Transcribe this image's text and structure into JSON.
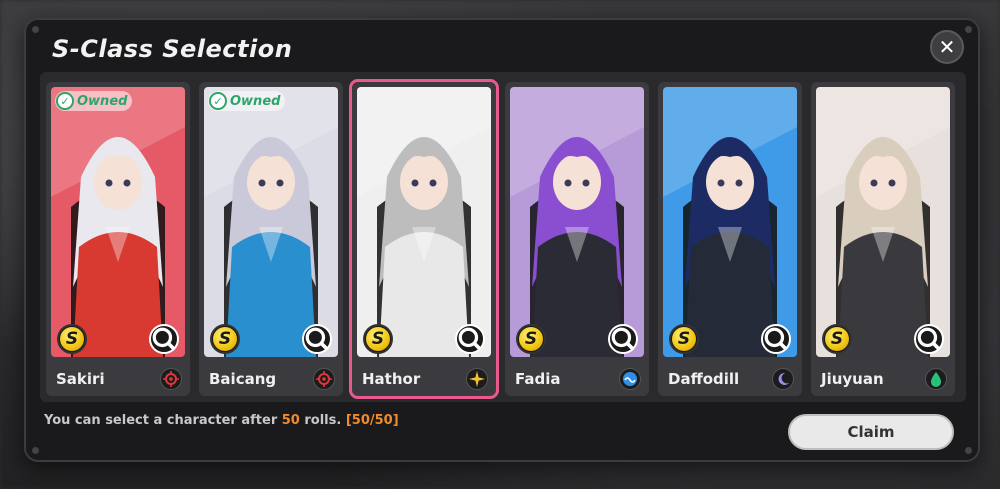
{
  "dialog": {
    "title": "S-Class Selection",
    "close_icon": "close-icon"
  },
  "characters": [
    {
      "name": "Sakiri",
      "owned": true,
      "owned_label": "Owned",
      "rank": "S",
      "element_icon": "crosshair-icon",
      "element_color": "#e0373b",
      "art_bg": "#e65a67",
      "hair": "#e8e8ee",
      "outfit": "#d83a32",
      "selected": false
    },
    {
      "name": "Baicang",
      "owned": true,
      "owned_label": "Owned",
      "rank": "S",
      "element_icon": "crosshair-icon",
      "element_color": "#e0373b",
      "art_bg": "#dcdce6",
      "hair": "#c9c9d9",
      "outfit": "#2a8fcf",
      "selected": false
    },
    {
      "name": "Hathor",
      "owned": false,
      "owned_label": "",
      "rank": "S",
      "element_icon": "star-burst-icon",
      "element_color": "#f2c230",
      "art_bg": "#efefef",
      "hair": "#bdbdbd",
      "outfit": "#e8e8e8",
      "selected": true
    },
    {
      "name": "Fadia",
      "owned": false,
      "owned_label": "",
      "rank": "S",
      "element_icon": "wave-icon",
      "element_color": "#2f8fe6",
      "art_bg": "#b79ad8",
      "hair": "#8a4fd0",
      "outfit": "#2b2b35",
      "selected": false
    },
    {
      "name": "Daffodill",
      "owned": false,
      "owned_label": "",
      "rank": "S",
      "element_icon": "moon-icon",
      "element_color": "#9b8bea",
      "art_bg": "#3f9be8",
      "hair": "#1d2b64",
      "outfit": "#242a38",
      "selected": false
    },
    {
      "name": "Jiuyuan",
      "owned": false,
      "owned_label": "",
      "rank": "S",
      "element_icon": "leaf-drop-icon",
      "element_color": "#2fbf7f",
      "art_bg": "#e8e0dc",
      "hair": "#d9cdbd",
      "outfit": "#3a3a3e",
      "selected": false
    }
  ],
  "footer": {
    "prefix": "You can select a character after ",
    "rolls": "50",
    "suffix": " rolls. ",
    "progress": "[50/50]"
  },
  "claim_label": "Claim",
  "colors": {
    "accent_selected": "#e85a8d",
    "owned_green": "#2fa46a",
    "highlight_orange": "#f08a2e"
  }
}
